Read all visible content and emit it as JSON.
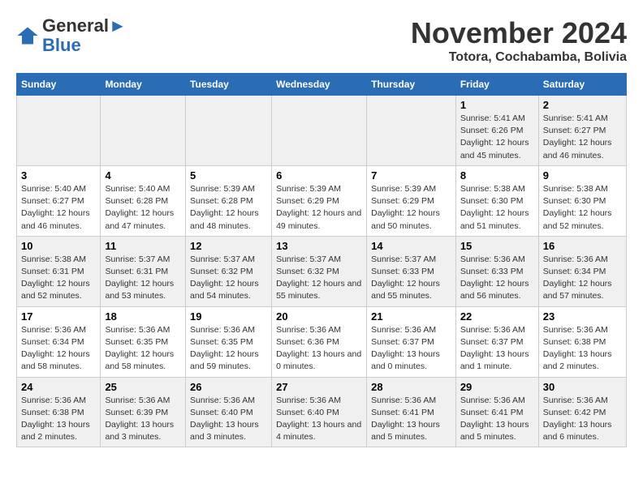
{
  "logo": {
    "line1": "General",
    "line2": "Blue"
  },
  "title": "November 2024",
  "location": "Totora, Cochabamba, Bolivia",
  "weekdays": [
    "Sunday",
    "Monday",
    "Tuesday",
    "Wednesday",
    "Thursday",
    "Friday",
    "Saturday"
  ],
  "weeks": [
    [
      {
        "day": "",
        "info": ""
      },
      {
        "day": "",
        "info": ""
      },
      {
        "day": "",
        "info": ""
      },
      {
        "day": "",
        "info": ""
      },
      {
        "day": "",
        "info": ""
      },
      {
        "day": "1",
        "info": "Sunrise: 5:41 AM\nSunset: 6:26 PM\nDaylight: 12 hours and 45 minutes."
      },
      {
        "day": "2",
        "info": "Sunrise: 5:41 AM\nSunset: 6:27 PM\nDaylight: 12 hours and 46 minutes."
      }
    ],
    [
      {
        "day": "3",
        "info": "Sunrise: 5:40 AM\nSunset: 6:27 PM\nDaylight: 12 hours and 46 minutes."
      },
      {
        "day": "4",
        "info": "Sunrise: 5:40 AM\nSunset: 6:28 PM\nDaylight: 12 hours and 47 minutes."
      },
      {
        "day": "5",
        "info": "Sunrise: 5:39 AM\nSunset: 6:28 PM\nDaylight: 12 hours and 48 minutes."
      },
      {
        "day": "6",
        "info": "Sunrise: 5:39 AM\nSunset: 6:29 PM\nDaylight: 12 hours and 49 minutes."
      },
      {
        "day": "7",
        "info": "Sunrise: 5:39 AM\nSunset: 6:29 PM\nDaylight: 12 hours and 50 minutes."
      },
      {
        "day": "8",
        "info": "Sunrise: 5:38 AM\nSunset: 6:30 PM\nDaylight: 12 hours and 51 minutes."
      },
      {
        "day": "9",
        "info": "Sunrise: 5:38 AM\nSunset: 6:30 PM\nDaylight: 12 hours and 52 minutes."
      }
    ],
    [
      {
        "day": "10",
        "info": "Sunrise: 5:38 AM\nSunset: 6:31 PM\nDaylight: 12 hours and 52 minutes."
      },
      {
        "day": "11",
        "info": "Sunrise: 5:37 AM\nSunset: 6:31 PM\nDaylight: 12 hours and 53 minutes."
      },
      {
        "day": "12",
        "info": "Sunrise: 5:37 AM\nSunset: 6:32 PM\nDaylight: 12 hours and 54 minutes."
      },
      {
        "day": "13",
        "info": "Sunrise: 5:37 AM\nSunset: 6:32 PM\nDaylight: 12 hours and 55 minutes."
      },
      {
        "day": "14",
        "info": "Sunrise: 5:37 AM\nSunset: 6:33 PM\nDaylight: 12 hours and 55 minutes."
      },
      {
        "day": "15",
        "info": "Sunrise: 5:36 AM\nSunset: 6:33 PM\nDaylight: 12 hours and 56 minutes."
      },
      {
        "day": "16",
        "info": "Sunrise: 5:36 AM\nSunset: 6:34 PM\nDaylight: 12 hours and 57 minutes."
      }
    ],
    [
      {
        "day": "17",
        "info": "Sunrise: 5:36 AM\nSunset: 6:34 PM\nDaylight: 12 hours and 58 minutes."
      },
      {
        "day": "18",
        "info": "Sunrise: 5:36 AM\nSunset: 6:35 PM\nDaylight: 12 hours and 58 minutes."
      },
      {
        "day": "19",
        "info": "Sunrise: 5:36 AM\nSunset: 6:35 PM\nDaylight: 12 hours and 59 minutes."
      },
      {
        "day": "20",
        "info": "Sunrise: 5:36 AM\nSunset: 6:36 PM\nDaylight: 13 hours and 0 minutes."
      },
      {
        "day": "21",
        "info": "Sunrise: 5:36 AM\nSunset: 6:37 PM\nDaylight: 13 hours and 0 minutes."
      },
      {
        "day": "22",
        "info": "Sunrise: 5:36 AM\nSunset: 6:37 PM\nDaylight: 13 hours and 1 minute."
      },
      {
        "day": "23",
        "info": "Sunrise: 5:36 AM\nSunset: 6:38 PM\nDaylight: 13 hours and 2 minutes."
      }
    ],
    [
      {
        "day": "24",
        "info": "Sunrise: 5:36 AM\nSunset: 6:38 PM\nDaylight: 13 hours and 2 minutes."
      },
      {
        "day": "25",
        "info": "Sunrise: 5:36 AM\nSunset: 6:39 PM\nDaylight: 13 hours and 3 minutes."
      },
      {
        "day": "26",
        "info": "Sunrise: 5:36 AM\nSunset: 6:40 PM\nDaylight: 13 hours and 3 minutes."
      },
      {
        "day": "27",
        "info": "Sunrise: 5:36 AM\nSunset: 6:40 PM\nDaylight: 13 hours and 4 minutes."
      },
      {
        "day": "28",
        "info": "Sunrise: 5:36 AM\nSunset: 6:41 PM\nDaylight: 13 hours and 5 minutes."
      },
      {
        "day": "29",
        "info": "Sunrise: 5:36 AM\nSunset: 6:41 PM\nDaylight: 13 hours and 5 minutes."
      },
      {
        "day": "30",
        "info": "Sunrise: 5:36 AM\nSunset: 6:42 PM\nDaylight: 13 hours and 6 minutes."
      }
    ]
  ]
}
